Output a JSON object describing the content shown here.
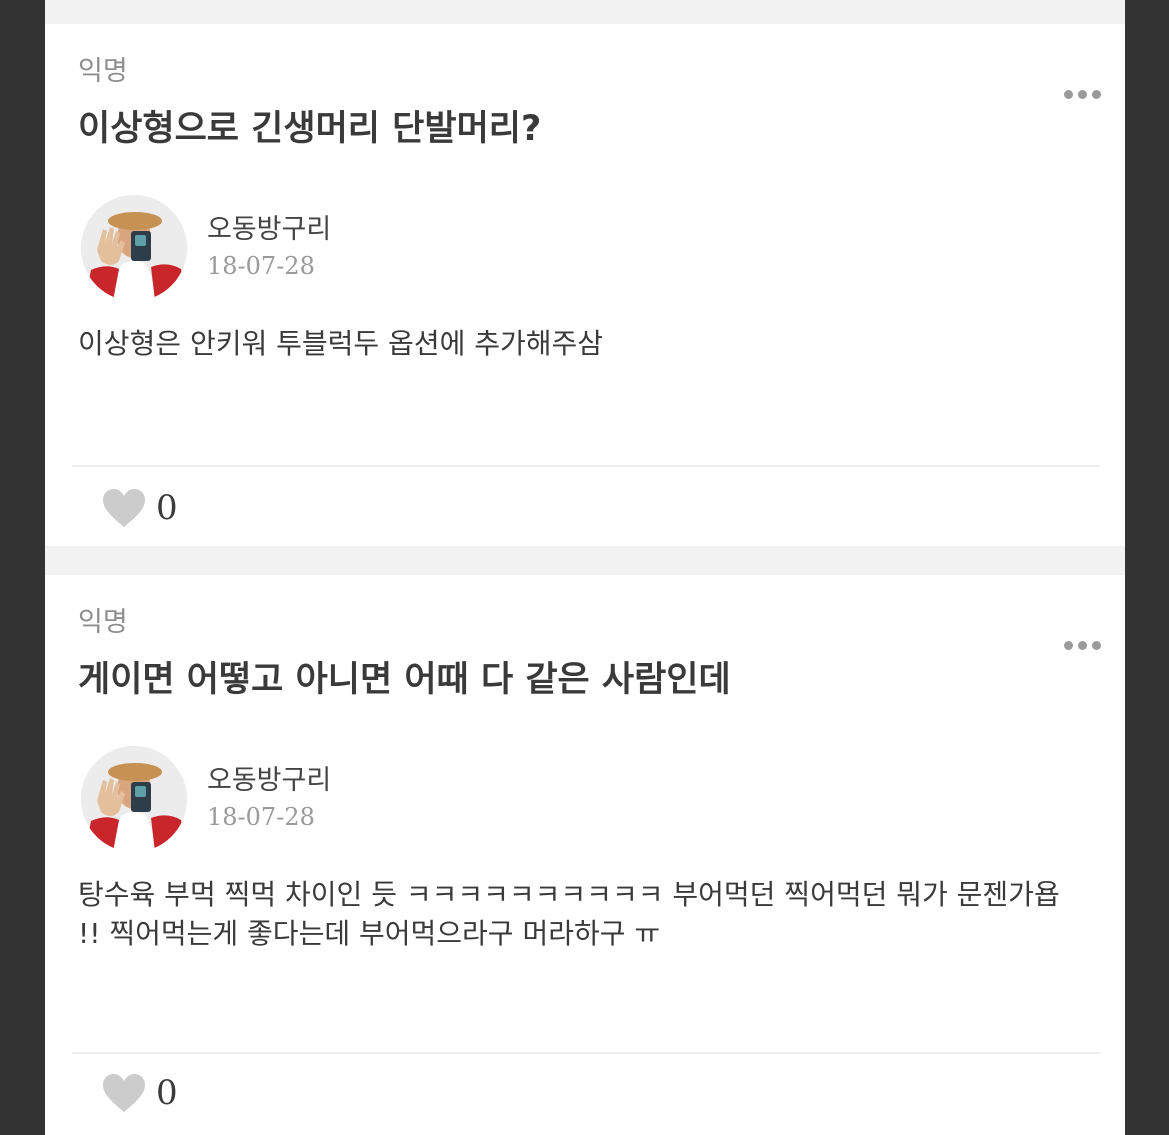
{
  "posts": [
    {
      "board": "익명",
      "title": "이상형으로 긴생머리 단발머리?",
      "author": "오동방구리",
      "date": "18-07-28",
      "body": "이상형은 안키워 투블럭두 옵션에 추가해주삼",
      "likes": "0",
      "more_icon": "more-dots-icon",
      "like_icon": "heart-icon"
    },
    {
      "board": "익명",
      "title": "게이면 어떻고 아니면 어때 다 같은 사람인데",
      "author": "오동방구리",
      "date": "18-07-28",
      "body": "탕수육 부먹 찍먹 차이인 듯 ㅋㅋㅋㅋㅋㅋㅋㅋㅋㅋ 부어먹던 찍어먹던 뭐가 문젠가욥 !! 찍어먹는게 좋다는데 부어먹으라구 머라하구 ㅠ",
      "likes": "0",
      "more_icon": "more-dots-icon",
      "like_icon": "heart-icon"
    }
  ],
  "colors": {
    "frame": "#333333",
    "page_background": "#f2f2f2",
    "card": "#ffffff",
    "heart": "#cccccc",
    "muted_text": "#8e8e8e"
  }
}
